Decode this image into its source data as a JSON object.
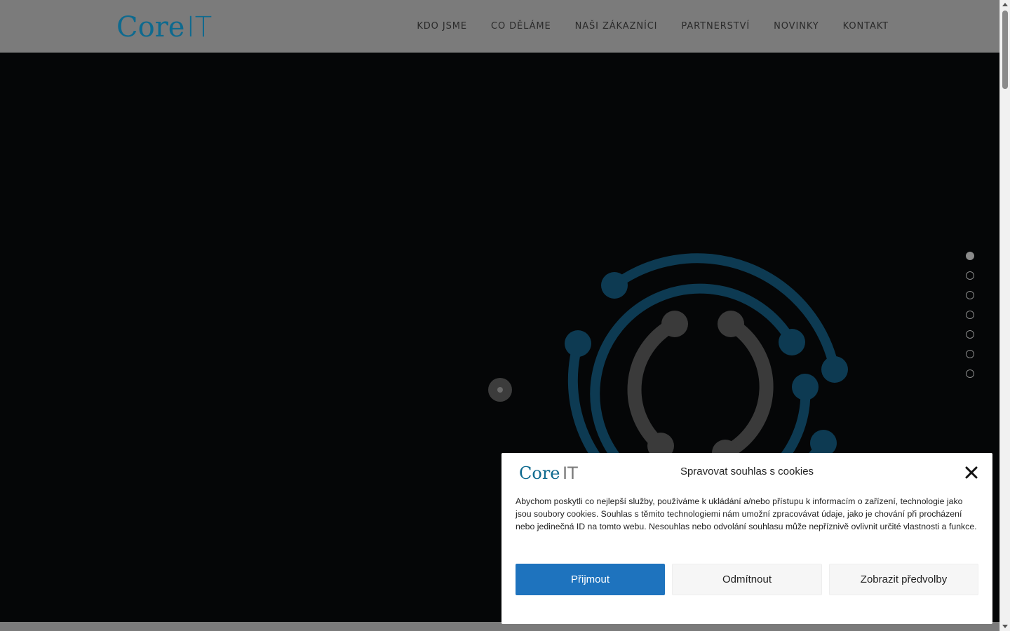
{
  "brand": {
    "logo_text_core": "Core",
    "logo_text_it": "IT",
    "primary_color": "#1e73be",
    "logo_color": "#0e6a8f",
    "graphic_blue": "#0d3a52",
    "graphic_gray": "#3a3a3a"
  },
  "header": {
    "nav": [
      {
        "label": "KDO JSME"
      },
      {
        "label": "CO DĚLÁME"
      },
      {
        "label": "NAŠI ZÁKAZNÍCI"
      },
      {
        "label": "PARTNERSTVÍ"
      },
      {
        "label": "NOVINKY"
      },
      {
        "label": "KONTAKT"
      }
    ]
  },
  "hero": {
    "graphic_icon": "circuit-circles-icon",
    "slides_count": 7,
    "active_slide": 1
  },
  "cookie_banner": {
    "title": "Spravovat souhlas s cookies",
    "text": "Abychom poskytli co nejlepší služby, používáme k ukládání a/nebo přístupu k informacím o zařízení, technologie jako jsou soubory cookies. Souhlas s těmito technologiemi nám umožní zpracovávat údaje, jako je chování při procházení nebo jedinečná ID na tomto webu. Nesouhlas nebo odvolání souhlasu může nepříznivě ovlivnit určité vlastnosti a funkce.",
    "accept_label": "Přijmout",
    "deny_label": "Odmítnout",
    "prefs_label": "Zobrazit předvolby",
    "close_icon": "close-icon"
  }
}
